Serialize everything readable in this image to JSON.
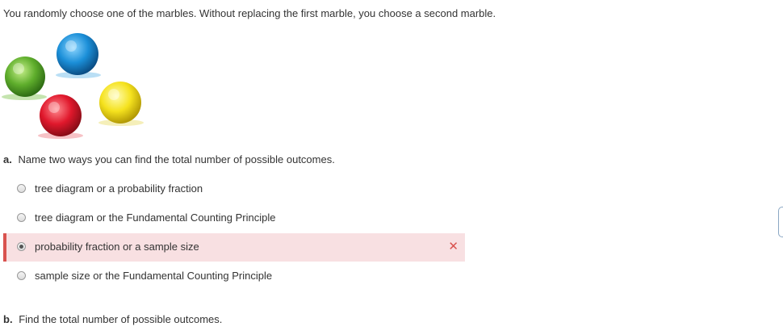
{
  "intro": "You randomly choose one of the marbles. Without replacing the first marble, you choose a second marble.",
  "marbles": [
    "green",
    "blue",
    "red",
    "yellow"
  ],
  "colors": {
    "wrong_bg": "#f8e0e2",
    "wrong_border": "#d9534f",
    "text": "#333333"
  },
  "part_a": {
    "label": "a.",
    "question": "Name two ways you can find the total number of possible outcomes.",
    "options": [
      {
        "label": "tree diagram or a probability fraction",
        "selected": false
      },
      {
        "label": "tree diagram or the Fundamental Counting Principle",
        "selected": false
      },
      {
        "label": "probability fraction or a sample size",
        "selected": true,
        "status": "incorrect"
      },
      {
        "label": "sample size or the Fundamental Counting Principle",
        "selected": false
      }
    ],
    "incorrect_mark": "✕"
  },
  "part_b": {
    "label": "b.",
    "question": "Find the total number of possible outcomes."
  }
}
